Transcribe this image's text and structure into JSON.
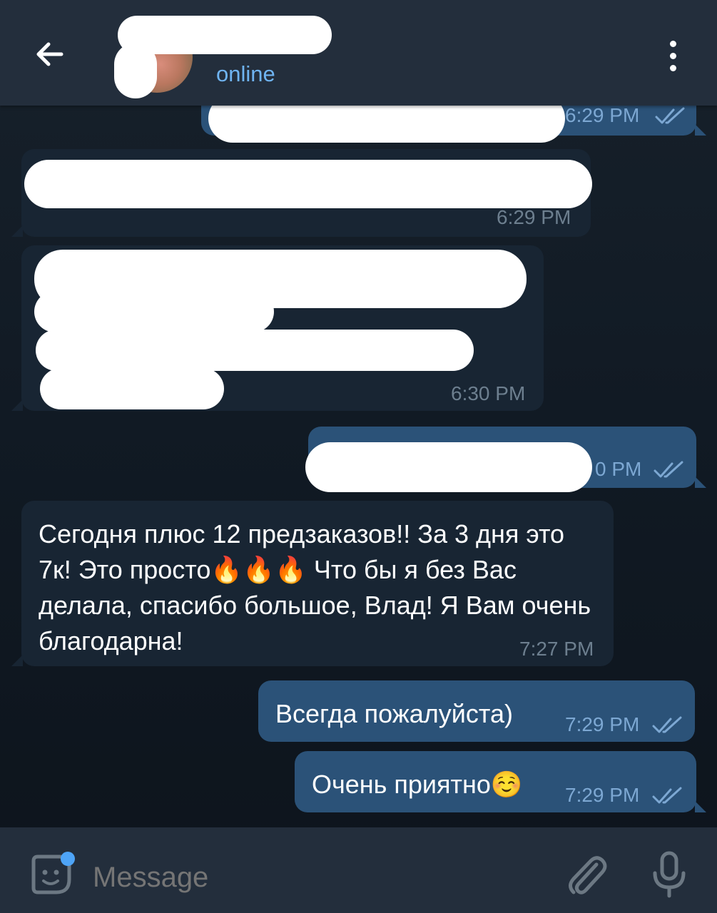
{
  "header": {
    "back_icon": "arrow-left-icon",
    "status": "online",
    "menu_icon": "more-vertical-icon"
  },
  "messages": [
    {
      "direction": "out",
      "text": "",
      "time": "6:29 PM",
      "read": true,
      "redacted": true
    },
    {
      "direction": "in",
      "text": "",
      "time": "6:29 PM",
      "redacted": true
    },
    {
      "direction": "in",
      "text": "",
      "time": "6:30 PM",
      "redacted": true
    },
    {
      "direction": "out",
      "text": "",
      "time": "0 PM",
      "read": true,
      "redacted": true
    },
    {
      "direction": "in",
      "text": "Сегодня плюс 12 предзаказов!! За 3 дня это 7к! Это просто🔥🔥🔥 Что бы я без Вас делала, спасибо большое, Влад! Я Вам очень благодарна!",
      "time": "7:27 PM"
    },
    {
      "direction": "out",
      "text": "Всегда пожалуйста)",
      "time": "7:29 PM",
      "read": true
    },
    {
      "direction": "out",
      "text": "Очень приятно☺️",
      "time": "7:29 PM",
      "read": true
    }
  ],
  "input": {
    "placeholder": "Message",
    "sticker_icon": "sticker-icon",
    "attach_icon": "paperclip-icon",
    "mic_icon": "microphone-icon"
  },
  "colors": {
    "header_bg": "#232e3c",
    "incoming_bubble": "#182533",
    "outgoing_bubble": "#2b5278",
    "accent": "#6fb4f2",
    "read_check": "#7da8d3"
  }
}
